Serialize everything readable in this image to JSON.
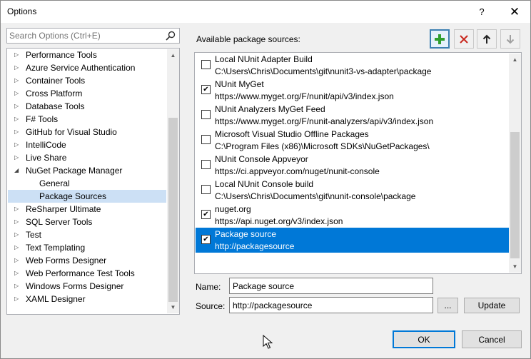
{
  "window": {
    "title": "Options",
    "help": "?",
    "close": "✕"
  },
  "search": {
    "placeholder": "Search Options (Ctrl+E)"
  },
  "tree": {
    "items": [
      {
        "label": "Performance Tools"
      },
      {
        "label": "Azure Service Authentication"
      },
      {
        "label": "Container Tools"
      },
      {
        "label": "Cross Platform"
      },
      {
        "label": "Database Tools"
      },
      {
        "label": "F# Tools"
      },
      {
        "label": "GitHub for Visual Studio"
      },
      {
        "label": "IntelliCode"
      },
      {
        "label": "Live Share"
      },
      {
        "label": "NuGet Package Manager"
      },
      {
        "label": "General"
      },
      {
        "label": "Package Sources"
      },
      {
        "label": "ReSharper Ultimate"
      },
      {
        "label": "SQL Server Tools"
      },
      {
        "label": "Test"
      },
      {
        "label": "Text Templating"
      },
      {
        "label": "Web Forms Designer"
      },
      {
        "label": "Web Performance Test Tools"
      },
      {
        "label": "Windows Forms Designer"
      },
      {
        "label": "XAML Designer"
      }
    ]
  },
  "sources": {
    "label": "Available package sources:",
    "items": [
      {
        "name": "Local NUnit Adapter Build",
        "source": "C:\\Users\\Chris\\Documents\\git\\nunit3-vs-adapter\\package",
        "checked": false
      },
      {
        "name": "NUnit MyGet",
        "source": "https://www.myget.org/F/nunit/api/v3/index.json",
        "checked": true
      },
      {
        "name": "NUnit Analyzers MyGet Feed",
        "source": "https://www.myget.org/F/nunit-analyzers/api/v3/index.json",
        "checked": false
      },
      {
        "name": "Microsoft Visual Studio Offline Packages",
        "source": "C:\\Program Files (x86)\\Microsoft SDKs\\NuGetPackages\\",
        "checked": false
      },
      {
        "name": "NUnit Console Appveyor",
        "source": "https://ci.appveyor.com/nuget/nunit-console",
        "checked": false
      },
      {
        "name": "Local NUnit Console build",
        "source": "C:\\Users\\Chris\\Documents\\git\\nunit-console\\package",
        "checked": false
      },
      {
        "name": "nuget.org",
        "source": "https://api.nuget.org/v3/index.json",
        "checked": true
      },
      {
        "name": "Package source",
        "source": "http://packagesource",
        "checked": true
      }
    ]
  },
  "form": {
    "name_label": "Name:",
    "name_value": "Package source",
    "source_label": "Source:",
    "source_value": "http://packagesource",
    "browse_label": "...",
    "update_label": "Update"
  },
  "footer": {
    "ok_label": "OK",
    "cancel_label": "Cancel"
  },
  "colors": {
    "selection": "#0078d7",
    "tree_selection": "#cce0f5",
    "add_icon": "#2e9e2e",
    "remove_icon": "#c8281e"
  }
}
